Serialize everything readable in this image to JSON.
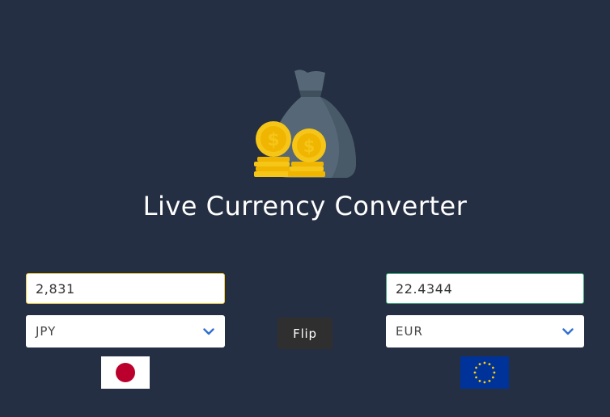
{
  "header": {
    "title": "Live Currency Converter",
    "logo_icon": "money-bag-with-coins-icon"
  },
  "from": {
    "amount": "2,831",
    "currency": "JPY",
    "flag_icon": "japan-flag-icon",
    "border_color": "#f2cc4a"
  },
  "to": {
    "amount": "22.4344",
    "currency": "EUR",
    "flag_icon": "eu-flag-icon",
    "border_color": "#3ea97a"
  },
  "actions": {
    "flip_label": "Flip"
  },
  "colors": {
    "background": "#252f43",
    "chevron": "#2f6fd1",
    "flip_button": "#2f2f2f"
  }
}
